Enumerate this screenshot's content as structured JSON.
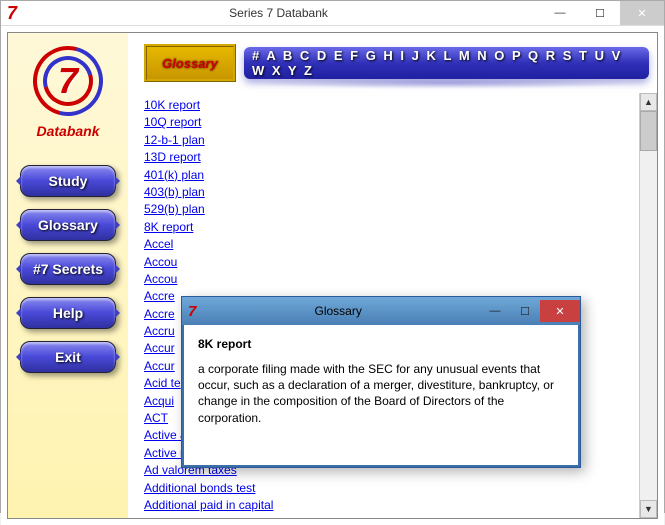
{
  "window": {
    "icon_text": "7",
    "title": "Series 7 Databank",
    "controls": {
      "minimize": "—",
      "maximize": "☐",
      "close": "✕"
    }
  },
  "sidebar": {
    "logo_text": "7",
    "brand": "Databank",
    "buttons": [
      "Study",
      "Glossary",
      "#7 Secrets",
      "Help",
      "Exit"
    ]
  },
  "glossary": {
    "badge": "Glossary",
    "alphabet": "# A B C D E F G H I J K L M N O P Q R S T U V W X Y Z",
    "terms": [
      "10K report",
      "10Q report",
      "12-b-1 plan",
      "13D report",
      "401(k) plan",
      "403(b) plan",
      "529(b) plan",
      "8K report",
      "Accel",
      "Accou",
      "Accou",
      "Accre",
      "Accre",
      "Accru",
      "Accur",
      "Accur",
      "Acid te",
      "Acqui",
      "ACT",
      "Active asset management",
      "Active return",
      "Ad valorem taxes",
      "Additional bonds test",
      "Additional paid in capital"
    ]
  },
  "popup": {
    "icon_text": "7",
    "title": "Glossary",
    "controls": {
      "minimize": "—",
      "maximize": "☐",
      "close": "✕"
    },
    "term": "8K report",
    "definition": "a corporate filing made with the SEC for any unusual events that occur, such as a declaration of a merger, divestiture, bankruptcy, or change in the composition of the Board of Directors of the corporation."
  }
}
